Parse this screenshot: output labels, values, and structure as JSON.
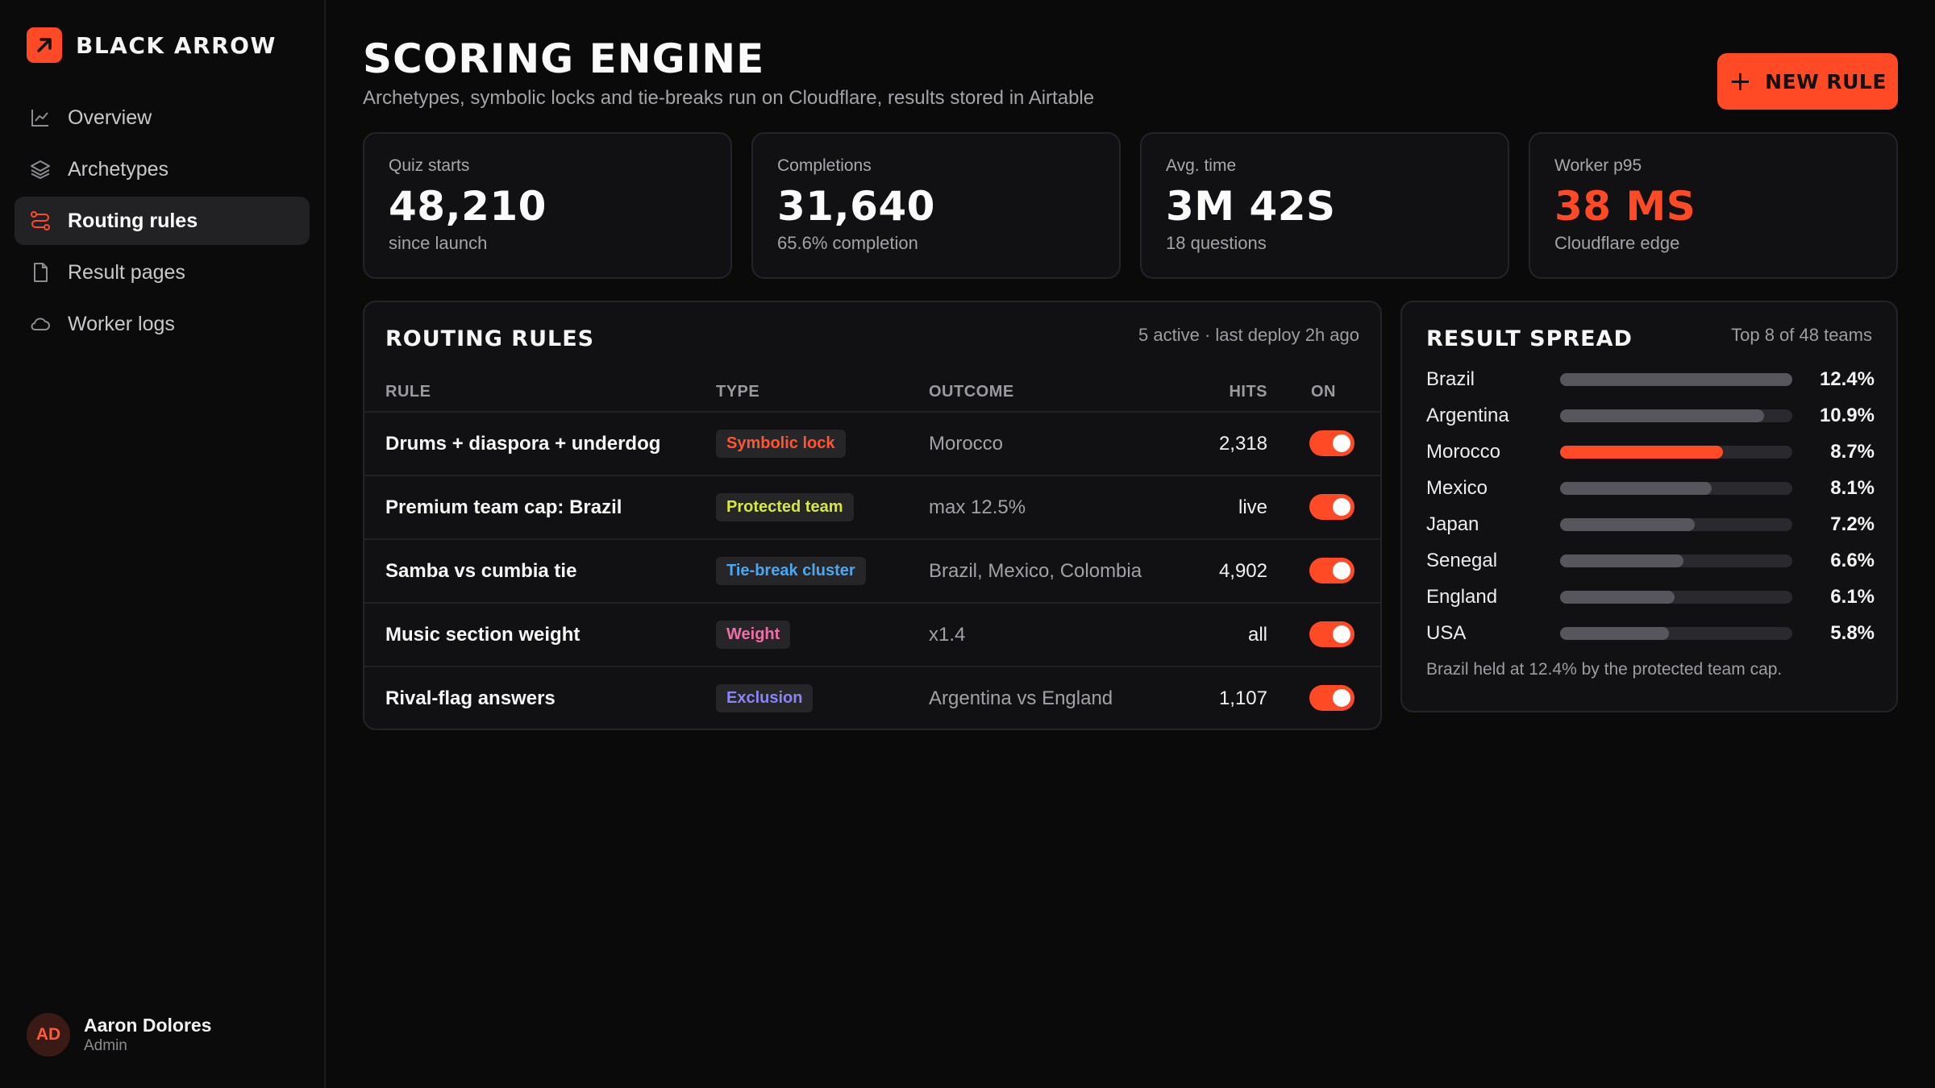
{
  "brand": {
    "name": "BLACK ARROW"
  },
  "sidebar": {
    "items": [
      {
        "label": "Overview",
        "icon": "line-chart-icon",
        "active": false
      },
      {
        "label": "Archetypes",
        "icon": "layers-icon",
        "active": false
      },
      {
        "label": "Routing rules",
        "icon": "routing-icon",
        "active": true
      },
      {
        "label": "Result pages",
        "icon": "file-icon",
        "active": false
      },
      {
        "label": "Worker logs",
        "icon": "cloud-icon",
        "active": false
      }
    ]
  },
  "user": {
    "initials": "AD",
    "name": "Aaron Dolores",
    "role": "Admin"
  },
  "header": {
    "title": "SCORING ENGINE",
    "subtitle": "Archetypes, symbolic locks and tie-breaks run on Cloudflare, results stored in Airtable",
    "new_rule_label": "NEW RULE"
  },
  "stats": [
    {
      "label": "Quiz starts",
      "value": "48,210",
      "sub": "since launch"
    },
    {
      "label": "Completions",
      "value": "31,640",
      "sub": "65.6% completion"
    },
    {
      "label": "Avg. time",
      "value": "3M 42S",
      "sub": "18 questions"
    },
    {
      "label": "Worker p95",
      "value": "38 MS",
      "sub": "Cloudflare edge"
    }
  ],
  "routing": {
    "title": "ROUTING RULES",
    "meta": "5 active · last deploy 2h ago",
    "columns": {
      "rule": "RULE",
      "type": "TYPE",
      "outcome": "OUTCOME",
      "hits": "HITS",
      "on": "ON"
    },
    "rows": [
      {
        "rule": "Drums + diaspora + underdog",
        "type": "Symbolic lock",
        "outcome": "Morocco",
        "hits": "2,318",
        "on": true
      },
      {
        "rule": "Premium team cap: Brazil",
        "type": "Protected team",
        "outcome": "max 12.5%",
        "hits": "live",
        "on": true
      },
      {
        "rule": "Samba vs cumbia tie",
        "type": "Tie-break cluster",
        "outcome": "Brazil, Mexico, Colombia",
        "hits": "4,902",
        "on": true
      },
      {
        "rule": "Music section weight",
        "type": "Weight",
        "outcome": "x1.4",
        "hits": "all",
        "on": true
      },
      {
        "rule": "Rival-flag answers",
        "type": "Exclusion",
        "outcome": "Argentina vs England",
        "hits": "1,107",
        "on": true
      }
    ]
  },
  "badge_colors": {
    "Symbolic lock": "#ff5534",
    "Protected team": "#d8e83a",
    "Tie-break cluster": "#4aa8f0",
    "Weight": "#ee6fa6",
    "Exclusion": "#8a84f5"
  },
  "spread": {
    "title": "RESULT SPREAD",
    "meta": "Top 8 of 48 teams",
    "max_percent": 12.4,
    "teams": [
      {
        "name": "Brazil",
        "value": "12.4%",
        "percent": 12.4,
        "highlight": false
      },
      {
        "name": "Argentina",
        "value": "10.9%",
        "percent": 10.9,
        "highlight": false
      },
      {
        "name": "Morocco",
        "value": "8.7%",
        "percent": 8.7,
        "highlight": true
      },
      {
        "name": "Mexico",
        "value": "8.1%",
        "percent": 8.1,
        "highlight": false
      },
      {
        "name": "Japan",
        "value": "7.2%",
        "percent": 7.2,
        "highlight": false
      },
      {
        "name": "Senegal",
        "value": "6.6%",
        "percent": 6.6,
        "highlight": false
      },
      {
        "name": "England",
        "value": "6.1%",
        "percent": 6.1,
        "highlight": false
      },
      {
        "name": "USA",
        "value": "5.8%",
        "percent": 5.8,
        "highlight": false
      }
    ],
    "note": "Brazil held at 12.4% by the protected team cap."
  },
  "colors": {
    "accent": "#ff4a25",
    "background": "#0a0a0b",
    "panel": "#111113"
  }
}
